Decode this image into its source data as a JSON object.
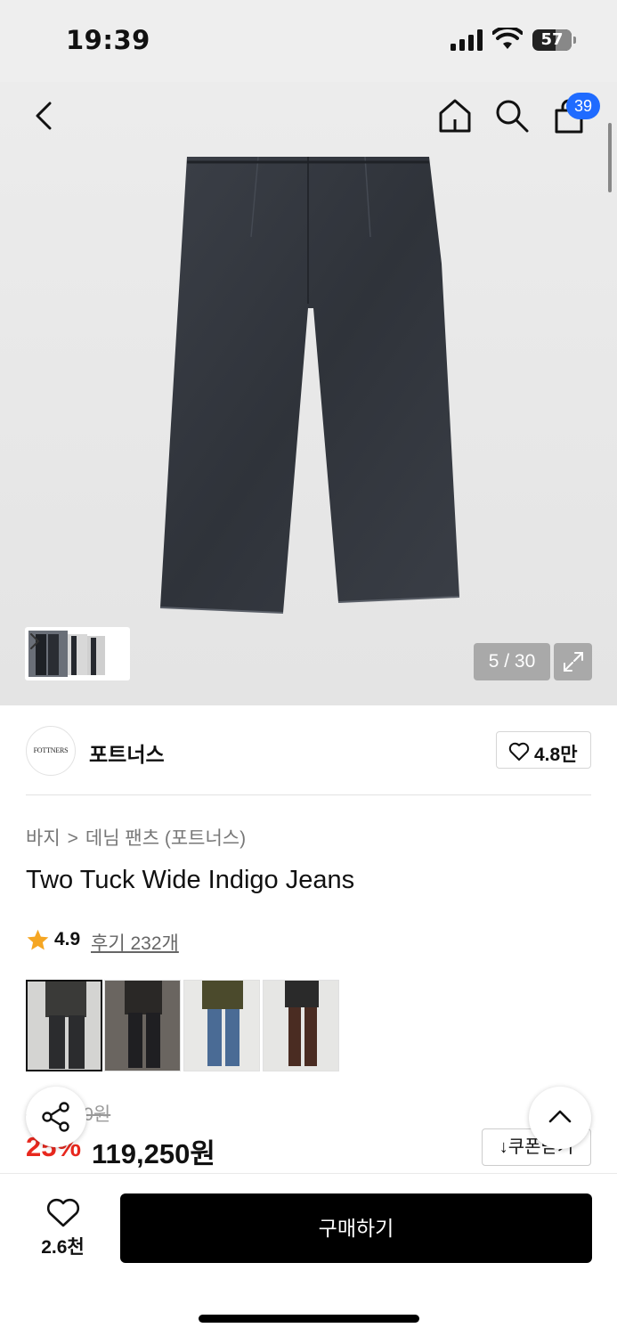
{
  "status_bar": {
    "time": "19:39",
    "battery": "57"
  },
  "nav": {
    "cart_count": "39",
    "icons": [
      "back-icon",
      "home-icon",
      "search-icon",
      "cart-icon"
    ]
  },
  "gallery": {
    "counter": "5 / 30"
  },
  "brand": {
    "logo_text": "FOTTNERS",
    "name": "포트너스",
    "like_count": "4.8만"
  },
  "breadcrumb": {
    "category": "바지",
    "subcategory": "데님 팬츠 (포트너스)"
  },
  "product": {
    "title": "Two Tuck Wide Indigo Jeans",
    "rating": "4.9",
    "reviews": "후기 232개",
    "old_price": "159,000원",
    "discount": "25%",
    "price": "119,250원",
    "coupon_label": "↓쿠폰받기"
  },
  "color_options": [
    {
      "name": "black",
      "color": "#2b2c2e",
      "selected": true
    },
    {
      "name": "black-leather",
      "color": "#1f1f22",
      "selected": false
    },
    {
      "name": "light-blue",
      "color": "#4a6b95",
      "selected": false
    },
    {
      "name": "brown",
      "color": "#4a2c22",
      "selected": false
    }
  ],
  "bottom_bar": {
    "wish_count": "2.6천",
    "buy_label": "구매하기"
  },
  "colors": {
    "accent": "#1f6bff",
    "discount": "#e8281e",
    "buy_bg": "#000000"
  }
}
